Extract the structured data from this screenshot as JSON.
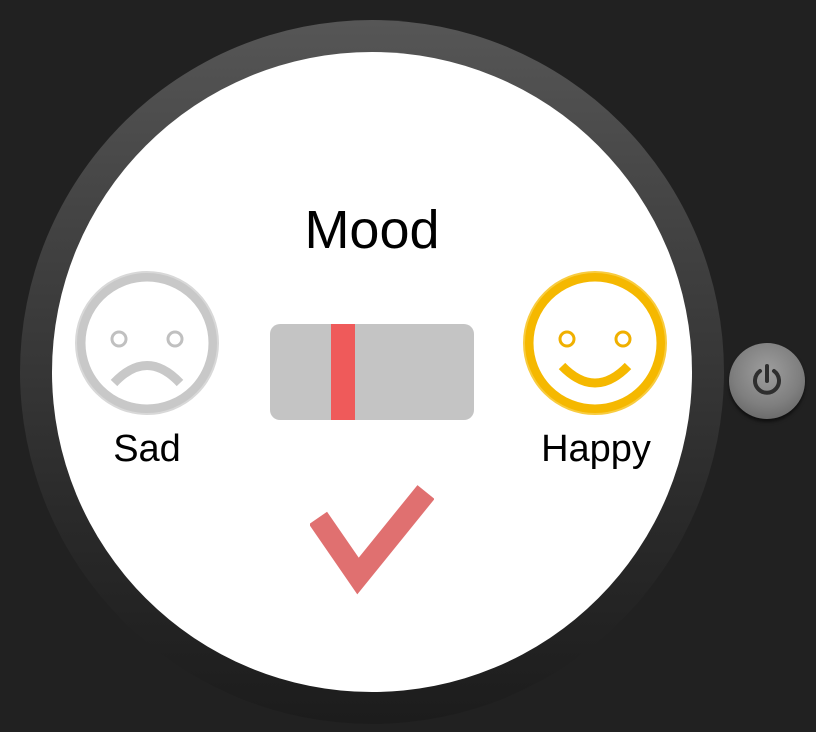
{
  "app": {
    "title": "Mood"
  },
  "mood_scale": {
    "min_label": "Sad",
    "max_label": "Happy",
    "min_icon": "sad-face-icon",
    "max_icon": "happy-face-icon",
    "value_fraction": 0.36
  },
  "icons": {
    "confirm": "checkmark-icon",
    "power": "power-icon"
  },
  "colors": {
    "sad_face": "#c8c8c8",
    "happy_face": "#f5b800",
    "slider_track": "#c4c4c4",
    "slider_thumb": "#ef5a5a",
    "checkmark": "#e07070",
    "bezel": "#4a4a4a",
    "background": "#212121"
  }
}
